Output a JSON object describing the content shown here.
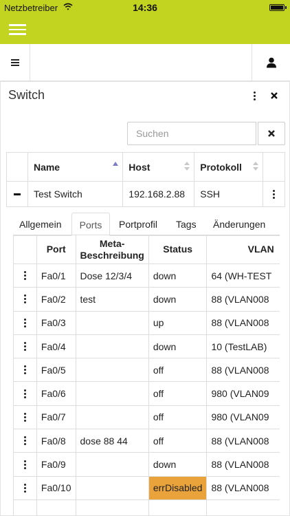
{
  "status_bar": {
    "carrier": "Netzbetreiber",
    "time": "14:36"
  },
  "panel": {
    "title": "Switch"
  },
  "search": {
    "placeholder": "Suchen"
  },
  "main_table": {
    "headers": [
      "Name",
      "Host",
      "Protokoll"
    ],
    "row": {
      "name": "Test Switch",
      "host": "192.168.2.88",
      "protocol": "SSH"
    }
  },
  "tabs": [
    "Allgemein",
    "Ports",
    "Portprofil",
    "Tags",
    "Änderungen"
  ],
  "active_tab": "Ports",
  "ports_table": {
    "headers": {
      "port": "Port",
      "meta_line1": "Meta-",
      "meta_line2": "Beschreibung",
      "status": "Status",
      "vlan": "VLAN"
    },
    "rows": [
      {
        "port": "Fa0/1",
        "meta": "Dose 12/3/4",
        "status": "down",
        "vlan": "64 (WH-TEST"
      },
      {
        "port": "Fa0/2",
        "meta": "test",
        "status": "down",
        "vlan": "88 (VLAN008"
      },
      {
        "port": "Fa0/3",
        "meta": "",
        "status": "up",
        "vlan": "88 (VLAN008"
      },
      {
        "port": "Fa0/4",
        "meta": "",
        "status": "down",
        "vlan": "10 (TestLAB)"
      },
      {
        "port": "Fa0/5",
        "meta": "",
        "status": "off",
        "vlan": "88 (VLAN008"
      },
      {
        "port": "Fa0/6",
        "meta": "",
        "status": "off",
        "vlan": "980 (VLAN09"
      },
      {
        "port": "Fa0/7",
        "meta": "",
        "status": "off",
        "vlan": "980 (VLAN09"
      },
      {
        "port": "Fa0/8",
        "meta": "dose 88 44",
        "status": "off",
        "vlan": "88 (VLAN008"
      },
      {
        "port": "Fa0/9",
        "meta": "",
        "status": "down",
        "vlan": "88 (VLAN008"
      },
      {
        "port": "Fa0/10",
        "meta": "",
        "status": "errDisabled",
        "vlan": "88 (VLAN008"
      },
      {
        "port": "",
        "meta": "",
        "status": "",
        "vlan": ""
      }
    ]
  },
  "colors": {
    "accent": "#c2d320",
    "err_disabled": "#e9a33a",
    "sort_active": "#7a7ac8"
  },
  "icons": [
    "wifi-icon",
    "battery-icon",
    "hamburger-menu-icon",
    "user-icon",
    "kebab-icon",
    "close-icon",
    "clear-search-icon",
    "collapse-icon",
    "sort-icon"
  ]
}
